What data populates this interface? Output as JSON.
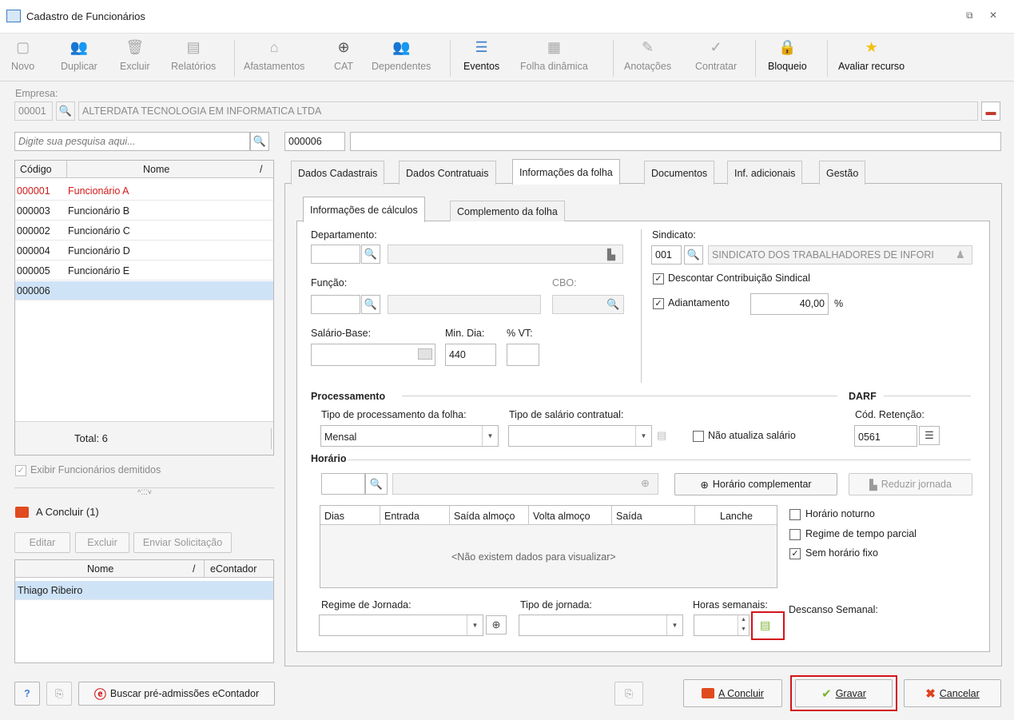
{
  "window": {
    "title": "Cadastro de Funcionários"
  },
  "toolbar": {
    "novo": "Novo",
    "duplicar": "Duplicar",
    "excluir": "Excluir",
    "relatorios": "Relatórios",
    "afastamentos": "Afastamentos",
    "cat": "CAT",
    "dependentes": "Dependentes",
    "eventos": "Eventos",
    "folha_dinamica": "Folha dinâmica",
    "anotacoes": "Anotações",
    "contratar": "Contratar",
    "bloqueio": "Bloqueio",
    "avaliar": "Avaliar recurso"
  },
  "empresa": {
    "label": "Empresa:",
    "code": "00001",
    "name": "ALTERDATA TECNOLOGIA EM INFORMATICA LTDA"
  },
  "search": {
    "placeholder": "Digite sua pesquisa aqui..."
  },
  "employee": {
    "code": "000006",
    "name": ""
  },
  "list": {
    "col_code": "Código",
    "col_name": "Nome",
    "sort": "/",
    "rows": [
      {
        "code": "000001",
        "name": "Funcionário A"
      },
      {
        "code": "000003",
        "name": "Funcionário B"
      },
      {
        "code": "000002",
        "name": "Funcionário C"
      },
      {
        "code": "000004",
        "name": "Funcionário D"
      },
      {
        "code": "000005",
        "name": "Funcionário E"
      },
      {
        "code": "000006",
        "name": ""
      }
    ],
    "total": "Total: 6"
  },
  "exibir_demitidos": "Exibir Funcionários demitidos",
  "concluir": {
    "title": "A Concluir (1)",
    "editar": "Editar",
    "excluir": "Excluir",
    "enviar": "Enviar Solicitação",
    "col_nome": "Nome",
    "sort": "/",
    "col_econtador": "eContador",
    "rows": [
      {
        "nome": "Thiago Ribeiro",
        "econtador": ""
      }
    ]
  },
  "tabs": [
    "Dados Cadastrais",
    "Dados Contratuais",
    "Informações da folha",
    "Documentos",
    "Inf. adicionais",
    "Gestão"
  ],
  "subtabs": [
    "Informações de cálculos",
    "Complemento da folha"
  ],
  "form": {
    "departamento": "Departamento:",
    "funcao": "Função:",
    "cbo": "CBO:",
    "salario_base": "Salário-Base:",
    "min_dia": "Min. Dia:",
    "min_dia_value": "440",
    "vt": "% VT:",
    "sindicato": "Sindicato:",
    "sindicato_code": "001",
    "sindicato_name": "SINDICATO DOS TRABALHADORES DE INFORI",
    "descontar": "Descontar Contribuição Sindical",
    "adiantamento": "Adiantamento",
    "adiantamento_value": "40,00",
    "percent": "%",
    "processamento": "Processamento",
    "darf": "DARF",
    "tipo_proc": "Tipo de processamento da folha:",
    "tipo_proc_value": "Mensal",
    "tipo_sal": "Tipo de salário contratual:",
    "nao_atualiza": "Não atualiza salário",
    "cod_ret": "Cód. Retenção:",
    "cod_ret_value": "0561",
    "horario": "Horário",
    "horario_comp": "Horário complementar",
    "reduzir": "Reduzir jornada",
    "grid_cols": [
      "Dias",
      "Entrada",
      "Saída almoço",
      "Volta almoço",
      "Saída",
      "Lanche"
    ],
    "grid_empty": "<Não existem dados para visualizar>",
    "noturno": "Horário noturno",
    "parcial": "Regime de tempo parcial",
    "sem_fixo": "Sem horário fixo",
    "regime": "Regime de Jornada:",
    "tipo_jornada": "Tipo de jornada:",
    "horas_sem": "Horas semanais:",
    "descanso": "Descanso Semanal:"
  },
  "footer": {
    "help": "?",
    "buscar": "Buscar pré-admissões eContador",
    "a_concluir": "A Concluir",
    "gravar": "Gravar",
    "cancelar": "Cancelar"
  },
  "colors": {
    "accent": "#3f7fcf",
    "red_text": "#d11a1a",
    "highlight": "#d4141a",
    "selection": "#cfe3f7"
  }
}
